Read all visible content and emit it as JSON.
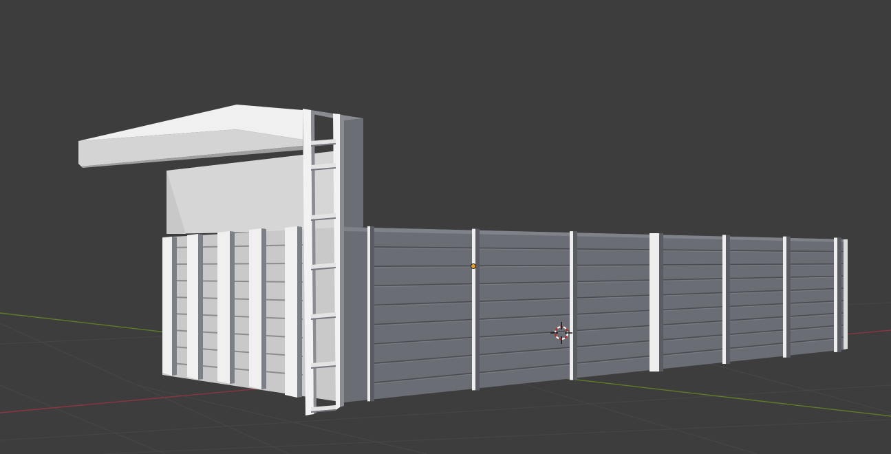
{
  "viewport": {
    "background_color": "#3d3d3d",
    "grid_line_color": "#4a4a4a",
    "x_axis_color": "#9a3a44",
    "y_axis_color": "#6a8a2a"
  },
  "scene": {
    "model": {
      "front_wall_color": "#6b6d75",
      "light_face_color": "#d8d8d8",
      "mid_face_color": "#a6a8ae",
      "dark_face_color": "#595b62"
    },
    "origin_point_color": "#e8a030",
    "cursor_colors": [
      "#c02525",
      "#ffffff"
    ]
  },
  "icons": [
    "3d-cursor-icon",
    "origin-point-icon"
  ]
}
